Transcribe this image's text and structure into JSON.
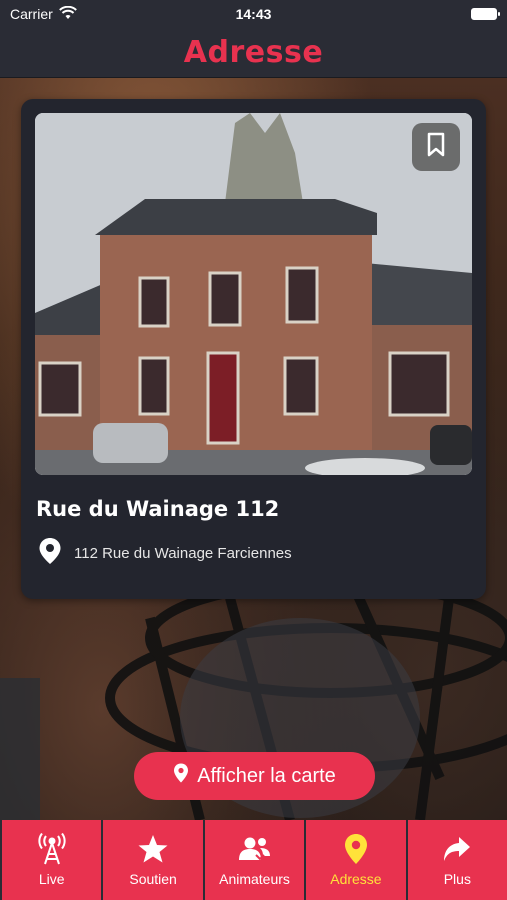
{
  "status_bar": {
    "carrier": "Carrier",
    "time": "14:43"
  },
  "header": {
    "title": "Adresse"
  },
  "place": {
    "name": "Rue du Wainage 112",
    "address": "112 Rue du Wainage Farciennes"
  },
  "map_button": {
    "label": "Afficher la carte"
  },
  "tabs": [
    {
      "label": "Live",
      "icon": "antenna-icon",
      "active": false
    },
    {
      "label": "Soutien",
      "icon": "star-icon",
      "active": false
    },
    {
      "label": "Animateurs",
      "icon": "people-icon",
      "active": false
    },
    {
      "label": "Adresse",
      "icon": "map-pin-icon",
      "active": true
    },
    {
      "label": "Plus",
      "icon": "share-arrow-icon",
      "active": false
    }
  ],
  "colors": {
    "accent": "#e8324f",
    "active_tab": "#ffe23a",
    "dark_bg": "#2a2c35",
    "card_bg": "#23252e"
  }
}
